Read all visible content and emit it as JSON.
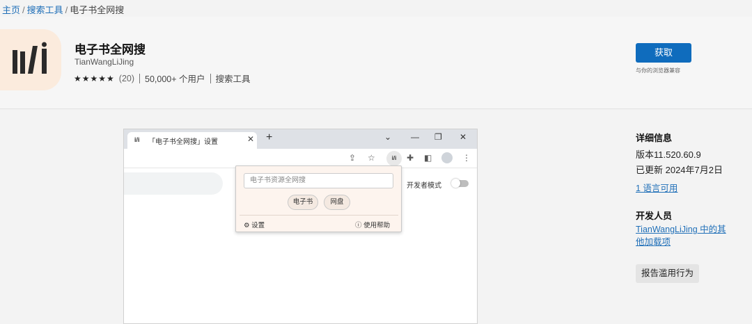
{
  "breadcrumb": {
    "home": "主页",
    "category": "搜索工具",
    "current": "电子书全网搜",
    "separator": "/"
  },
  "extension": {
    "title": "电子书全网搜",
    "author": "TianWangLiJing",
    "stars": "★★★★★",
    "rating_count": "(20)",
    "users": "50,000+ 个用户",
    "category": "搜索工具",
    "get_label": "获取",
    "compat_note": "与你的浏览器兼容"
  },
  "browser": {
    "tab_title": "「电子书全网搜」设置",
    "extension_badge": "i/i",
    "dev_mode_label": "开发者模式"
  },
  "popup": {
    "search_placeholder": "电子书资源全网搜",
    "chip_ebook": "电子书",
    "chip_netdisk": "网盘",
    "settings_label": "设置",
    "help_label": "使用帮助"
  },
  "details": {
    "heading": "详细信息",
    "version": "版本11.520.60.9",
    "updated": "已更新 2024年7月2日",
    "languages": "1 语言可用"
  },
  "developer": {
    "heading": "开发人员",
    "more_link": "TianWangLiJing 中的其他加载项",
    "report_label": "报告滥用行为"
  },
  "colors": {
    "accent": "#0f6cbd",
    "link": "#1f6fb8",
    "logo_bg": "#fbebdd"
  }
}
